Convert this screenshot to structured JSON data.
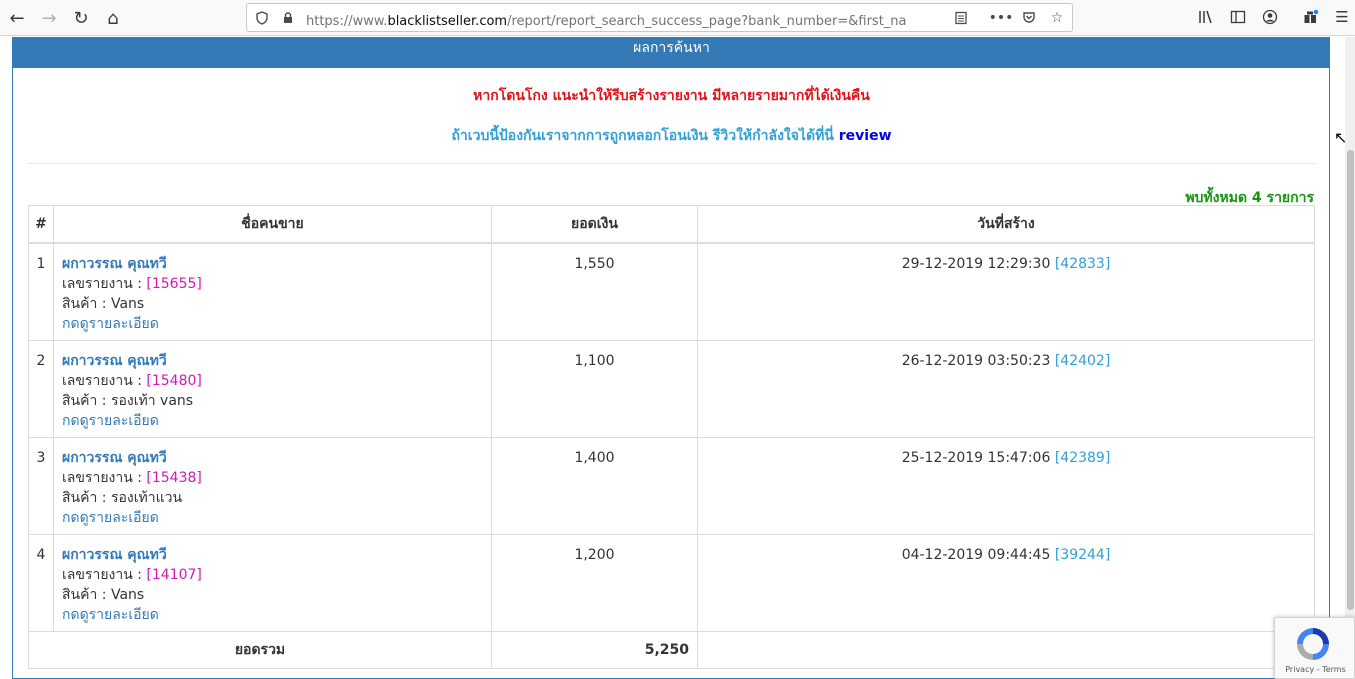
{
  "browser": {
    "url_prefix": "https://www.",
    "url_host": "blacklistseller.com",
    "url_path": "/report/report_search_success_page?bank_number=&first_name=ผกา"
  },
  "panel": {
    "heading": "ผลการค้นหา",
    "alert_red": "หากโดนโกง แนะนำให้รีบสร้างรายงาน มีหลายรายมากที่ได้เงินคืน",
    "alert_blue": "ถ้าเวบนี้ป้องกันเราจากการถูกหลอกโอนเงิน รีวิวให้กำลังใจได้ที่นี่",
    "review_link": "review",
    "found_text": "พบทั้งหมด 4 รายการ"
  },
  "table": {
    "headers": [
      "#",
      "ชื่อคนขาย",
      "ยอดเงิน",
      "วันที่สร้าง"
    ],
    "report_label": "เลขรายงาน : ",
    "product_label": "สินค้า : ",
    "detail_link": "กดดูรายละเอียด",
    "rows": [
      {
        "no": "1",
        "seller": "ผกาวรรณ คุณทวี",
        "report": "[15655]",
        "product": "Vans",
        "amount": "1,550",
        "date": "29-12-2019 12:29:30",
        "id": "[42833]"
      },
      {
        "no": "2",
        "seller": "ผกาวรรณ คุณทวี",
        "report": "[15480]",
        "product": "รองเท้า vans",
        "amount": "1,100",
        "date": "26-12-2019 03:50:23",
        "id": "[42402]"
      },
      {
        "no": "3",
        "seller": "ผกาวรรณ คุณทวี",
        "report": "[15438]",
        "product": "รองเท้าแวน",
        "amount": "1,400",
        "date": "25-12-2019 15:47:06",
        "id": "[42389]"
      },
      {
        "no": "4",
        "seller": "ผกาวรรณ คุณทวี",
        "report": "[14107]",
        "product": "Vans",
        "amount": "1,200",
        "date": "04-12-2019 09:44:45",
        "id": "[39244]"
      }
    ],
    "total_label": "ยอดรวม",
    "total_value": "5,250"
  },
  "recaptcha": {
    "terms": "Privacy - Terms"
  }
}
